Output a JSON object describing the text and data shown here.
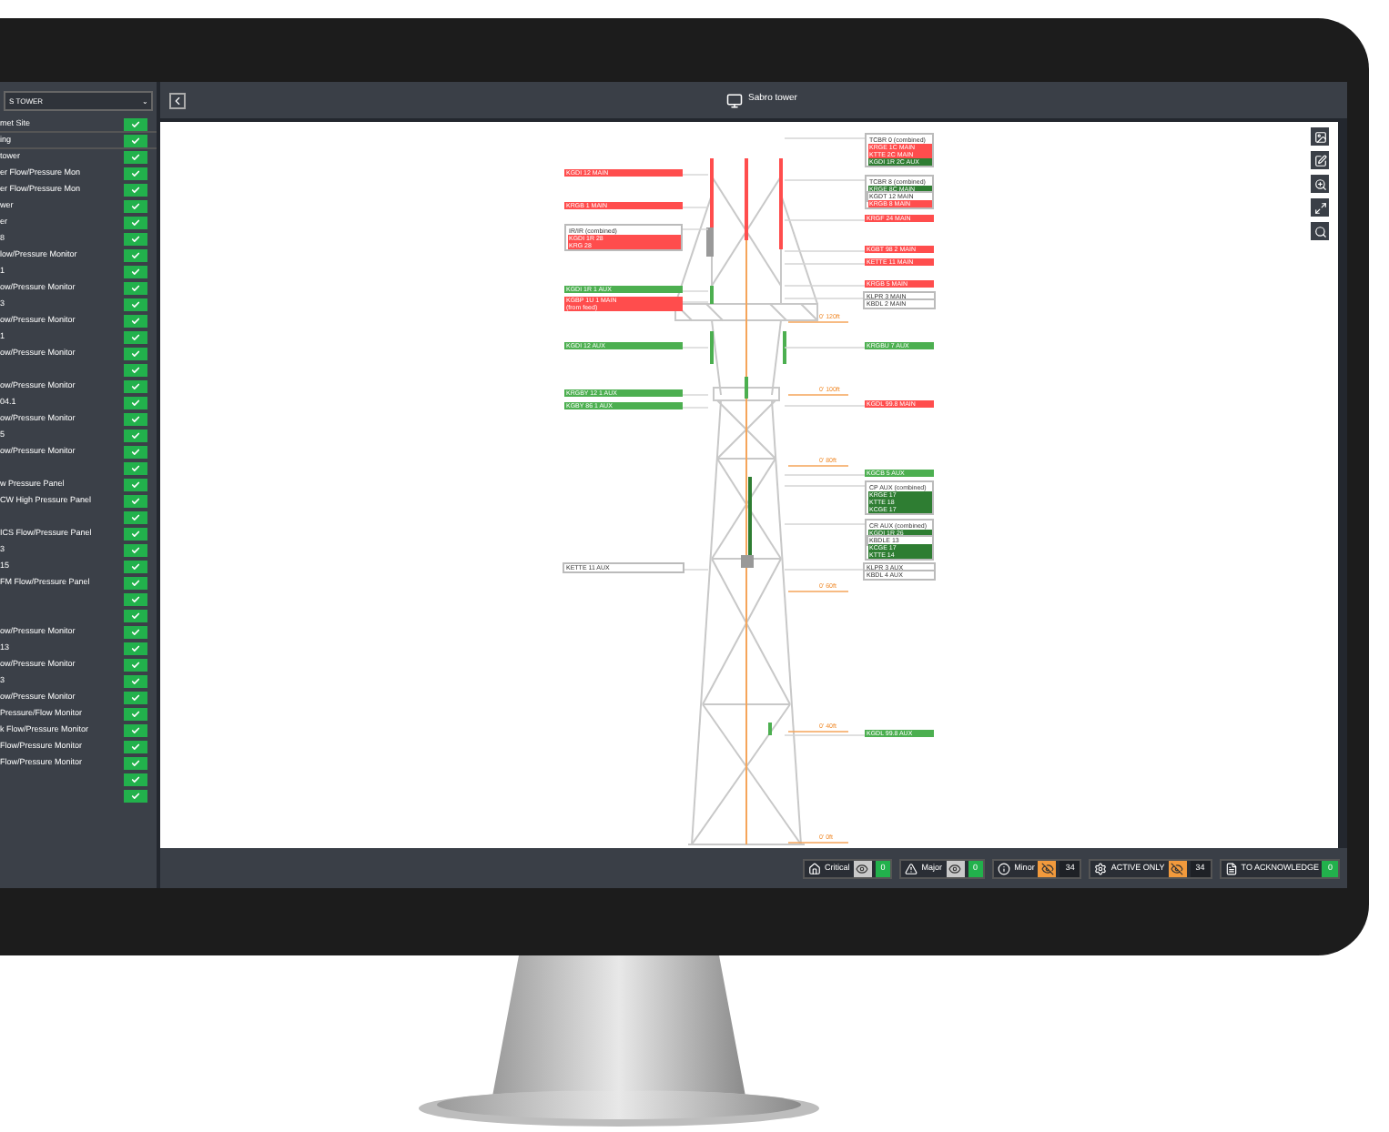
{
  "sidebar": {
    "header": "S TOWER",
    "header_caret": "⌄",
    "rows": [
      {
        "label": "met Site",
        "checked": true
      },
      {
        "label": "ing",
        "checked": true
      },
      {
        "label": "tower",
        "checked": true
      },
      {
        "label": "er Flow/Pressure Mon",
        "checked": true
      },
      {
        "label": "er Flow/Pressure Mon",
        "checked": true
      },
      {
        "label": "wer",
        "checked": true
      },
      {
        "label": "er",
        "checked": true
      },
      {
        "label": "8",
        "checked": true
      },
      {
        "label": "low/Pressure Monitor",
        "checked": true
      },
      {
        "label": "1",
        "checked": true
      },
      {
        "label": "ow/Pressure Monitor",
        "checked": true
      },
      {
        "label": "3",
        "checked": true
      },
      {
        "label": "ow/Pressure Monitor",
        "checked": true
      },
      {
        "label": "1",
        "checked": true
      },
      {
        "label": "ow/Pressure Monitor",
        "checked": true
      },
      {
        "checked": true
      },
      {
        "label": "ow/Pressure Monitor",
        "checked": true
      },
      {
        "label": "04.1",
        "checked": true
      },
      {
        "label": "ow/Pressure Monitor",
        "checked": true
      },
      {
        "label": "5",
        "checked": true
      },
      {
        "label": "ow/Pressure Monitor",
        "checked": true
      },
      {
        "checked": true
      },
      {
        "label": "w Pressure Panel",
        "checked": true
      },
      {
        "label": "CW High Pressure Panel",
        "checked": true
      },
      {
        "checked": true
      },
      {
        "label": "ICS Flow/Pressure Panel",
        "checked": true
      },
      {
        "label": "3",
        "checked": true
      },
      {
        "label": "15",
        "checked": true
      },
      {
        "label": "FM Flow/Pressure Panel",
        "checked": true
      },
      {
        "checked": true
      },
      {
        "checked": true
      },
      {
        "label": "ow/Pressure Monitor",
        "checked": true
      },
      {
        "label": "13",
        "checked": true
      },
      {
        "label": "ow/Pressure Monitor",
        "checked": true
      },
      {
        "label": "3",
        "checked": true
      },
      {
        "label": "ow/Pressure Monitor",
        "checked": true
      },
      {
        "label": "Pressure/Flow Monitor",
        "checked": true
      },
      {
        "label": "k Flow/Pressure Monitor",
        "checked": true
      },
      {
        "label": "Flow/Pressure Monitor",
        "checked": true
      },
      {
        "label": "Flow/Pressure Monitor",
        "checked": true
      },
      {
        "checked": true
      },
      {
        "checked": true
      }
    ]
  },
  "header": {
    "title": "Sabro tower"
  },
  "labels": [
    {
      "lines": [
        {
          "text": "KGDI 12 MAIN",
          "color": "#ff4d4d"
        }
      ]
    },
    {
      "lines": [
        {
          "text": "KRGB 1 MAIN",
          "color": "#ff4d4d"
        }
      ]
    },
    {
      "title": "IR/IR (combined)",
      "lines": [
        {
          "text": "KGDI 1R 28",
          "color": "#ff4d4d"
        },
        {
          "text": "KRG 28",
          "color": "#ff4d4d"
        }
      ]
    },
    {
      "lines": [
        {
          "text": "KGDI 1R 1 AUX",
          "color": "#4caf50"
        }
      ]
    },
    {
      "lines": [
        {
          "text": "KGBP 1U 1 MAIN",
          "color": "#ff4d4d"
        },
        {
          "text": "(from feed)",
          "color": "#ff4d4d"
        }
      ]
    },
    {
      "lines": [
        {
          "text": "KGDI 12 AUX",
          "color": "#4caf50"
        }
      ]
    },
    {
      "lines": [
        {
          "text": "KRGBY 12 1 AUX",
          "color": "#4caf50"
        }
      ]
    },
    {
      "lines": [
        {
          "text": "KGBY 86 1 AUX",
          "color": "#4caf50"
        }
      ]
    },
    {
      "lines": [
        {
          "text": "KETTE 11 AUX",
          "color": "#ffffff"
        }
      ]
    },
    {
      "title": "TCBR 0 (combined)",
      "lines": [
        {
          "text": "KRGE 1C MAIN",
          "color": "#ff4d4d"
        },
        {
          "text": "KTTE 2C MAIN",
          "color": "#ff4d4d"
        },
        {
          "text": "KGDI 1R 2C AUX",
          "color": "#2e7d32"
        }
      ]
    },
    {
      "title": "TCBR 8 (combined)",
      "lines": [
        {
          "text": "KRGE 8C MAIN",
          "color": "#2e7d32"
        },
        {
          "text": "KGDT 12 MAIN",
          "color": "#ffffff"
        },
        {
          "text": "KRGB 8 MAIN",
          "color": "#ff4d4d"
        }
      ]
    },
    {
      "lines": [
        {
          "text": "KRGF 24 MAIN",
          "color": "#ff4d4d"
        }
      ]
    },
    {
      "lines": [
        {
          "text": "KGBT 98 2 MAIN",
          "color": "#ff4d4d"
        }
      ]
    },
    {
      "lines": [
        {
          "text": "KETTE 11 MAIN",
          "color": "#ff4d4d"
        }
      ]
    },
    {
      "lines": [
        {
          "text": "KRGB 5 MAIN",
          "color": "#ff4d4d"
        }
      ]
    },
    {
      "lines": [
        {
          "text": "KLPR 3 MAIN",
          "color": "#ffffff"
        },
        {
          "text": "KBDL 2 MAIN",
          "color": "#ffffff"
        }
      ]
    },
    {
      "lines": [
        {
          "text": "KRGBU 7 AUX",
          "color": "#4caf50"
        }
      ]
    },
    {
      "lines": [
        {
          "text": "KGDL 99.8 MAIN",
          "color": "#ff4d4d"
        }
      ]
    },
    {
      "lines": [
        {
          "text": "KGCB 5 AUX",
          "color": "#4caf50"
        }
      ]
    },
    {
      "title": "CP AUX (combined)",
      "lines": [
        {
          "text": "KRGE 17",
          "color": "#2e7d32"
        },
        {
          "text": "KTTE 18",
          "color": "#2e7d32"
        },
        {
          "text": "KCGE 17",
          "color": "#2e7d32"
        }
      ]
    },
    {
      "title": "CR AUX (combined)",
      "lines": [
        {
          "text": "KGDI 1R 26",
          "color": "#2e7d32"
        },
        {
          "text": "KBDLE 13",
          "color": "#ffffff"
        },
        {
          "text": "KCGE 17",
          "color": "#2e7d32"
        },
        {
          "text": "KTTE 14",
          "color": "#2e7d32"
        }
      ]
    },
    {
      "lines": [
        {
          "text": "KLPR 3 AUX",
          "color": "#ffffff"
        },
        {
          "text": "KBDL 4 AUX",
          "color": "#ffffff"
        }
      ]
    },
    {
      "lines": [
        {
          "text": "KGDL 99.8 AUX",
          "color": "#4caf50"
        }
      ]
    }
  ],
  "height_marks": [
    "0' 120ft",
    "0' 100ft",
    "0' 80ft",
    "0' 60ft",
    "0' 40ft",
    "0' 0ft"
  ],
  "status_bar": [
    {
      "kind": "critical",
      "label": "Critical",
      "visible": true,
      "count": "0",
      "color": "#22b14c"
    },
    {
      "kind": "major",
      "label": "Major",
      "visible": true,
      "count": "0",
      "color": "#22b14c"
    },
    {
      "kind": "minor",
      "label": "Minor",
      "visible": false,
      "count": "34",
      "color": "#1e2126"
    },
    {
      "kind": "active",
      "label": "ACTIVE ONLY",
      "visible": false,
      "count": "34",
      "color": "#1e2126"
    },
    {
      "kind": "ack",
      "label": "TO ACKNOWLEDGE",
      "count": "0",
      "color": "#22b14c"
    }
  ]
}
